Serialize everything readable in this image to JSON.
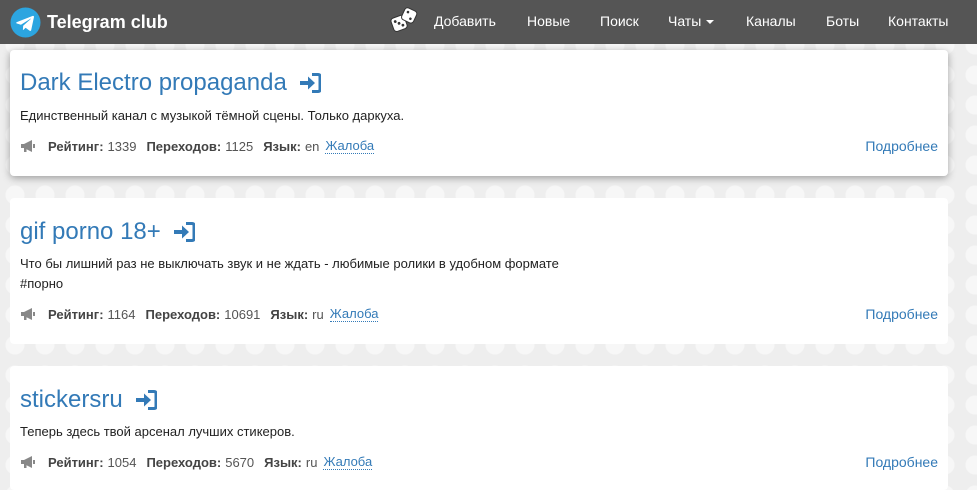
{
  "brand": {
    "name": "Telegram club"
  },
  "nav": {
    "add": "Добавить",
    "new": "Новые",
    "search": "Поиск",
    "chats": "Чаты",
    "channels": "Каналы",
    "bots": "Боты",
    "contacts": "Контакты"
  },
  "labels": {
    "rating": "Рейтинг:",
    "visits": "Переходов:",
    "language": "Язык:",
    "complaint": "Жалоба",
    "more": "Подробнее"
  },
  "channels": [
    {
      "title": "Dark Electro propaganda",
      "description": "Единственный канал с музыкой тёмной сцены. Только даркуха.",
      "rating": "1339",
      "visits": "1125",
      "language": "en"
    },
    {
      "title": "gif porno 18+",
      "description": "Что бы лишний раз не выключать звук и не ждать - любимые ролики в удобном формате",
      "description2": "#порно",
      "rating": "1164",
      "visits": "10691",
      "language": "ru"
    },
    {
      "title": "stickersru",
      "description": "Теперь здесь твой арсенал лучших стикеров.",
      "rating": "1054",
      "visits": "5670",
      "language": "ru"
    }
  ],
  "colors": {
    "navbar": "#555555",
    "link": "#337ab7",
    "telegram": "#2ca5e0"
  }
}
